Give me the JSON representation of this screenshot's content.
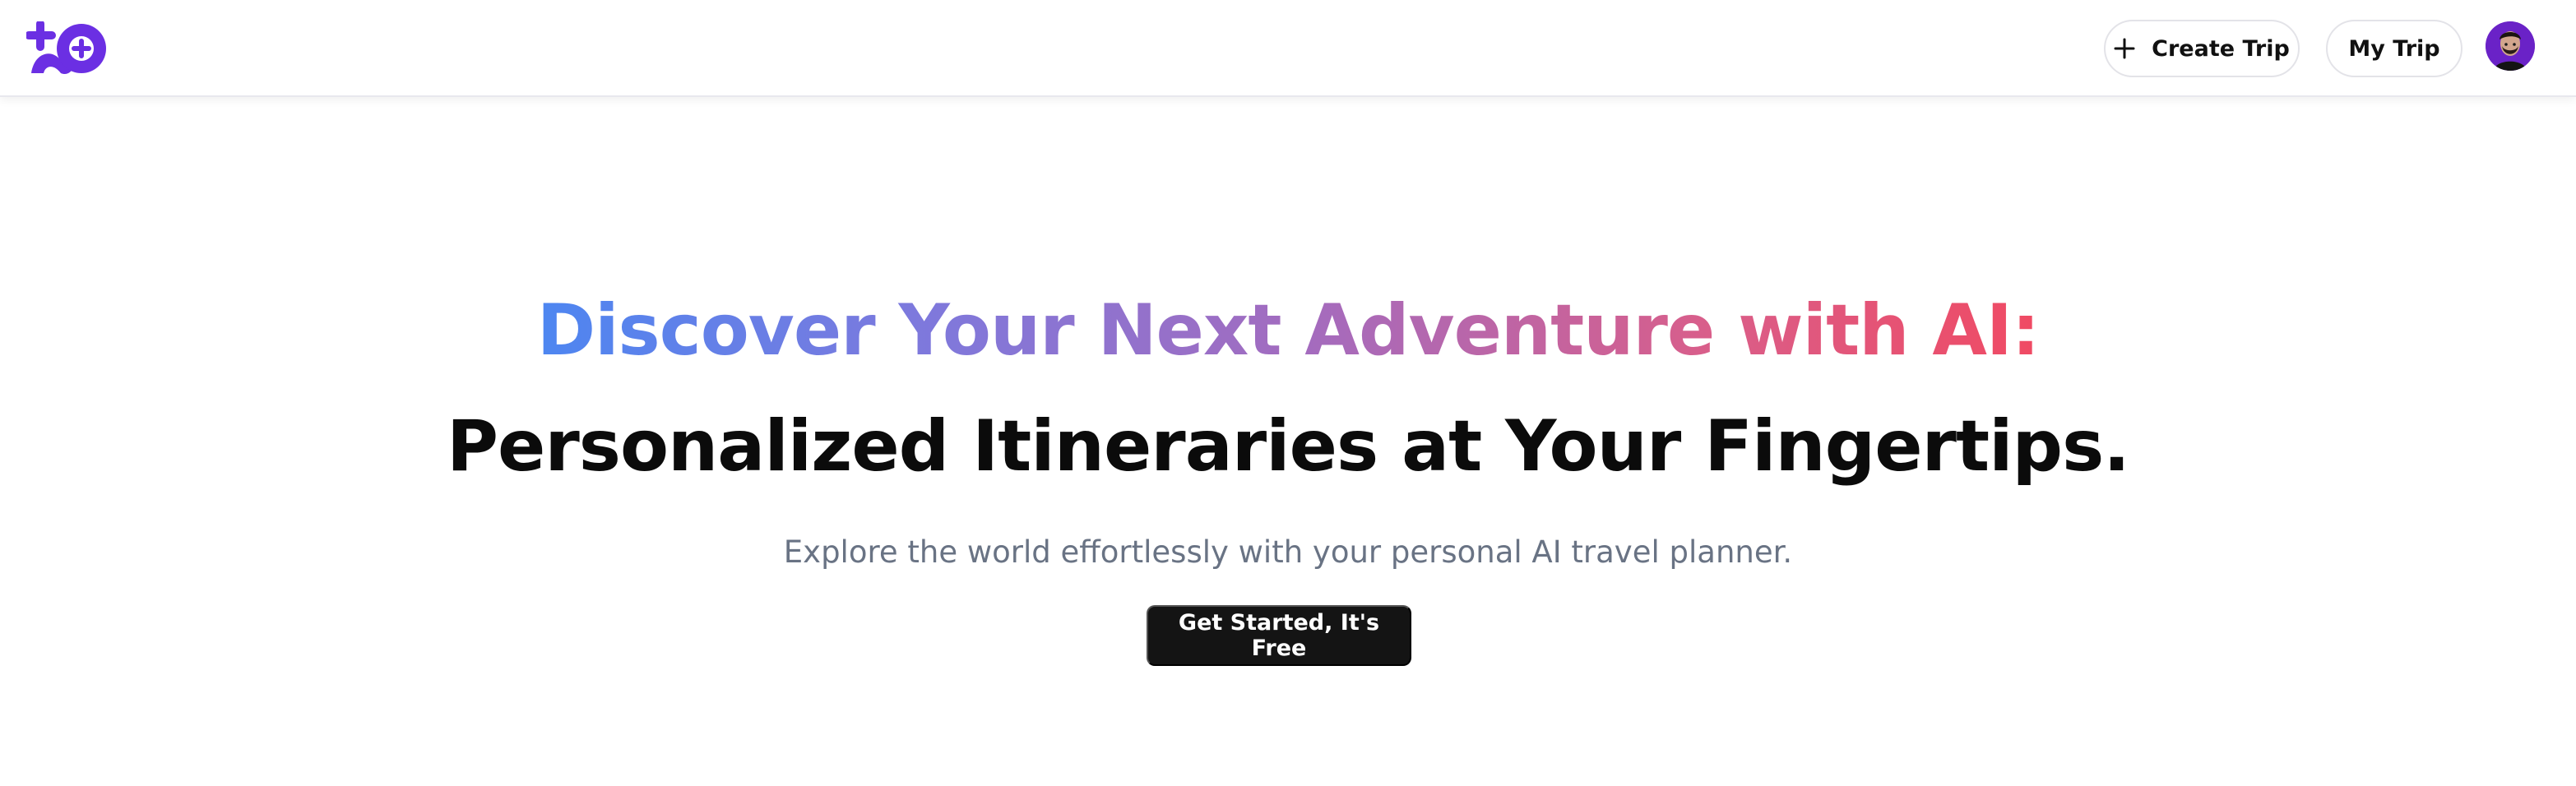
{
  "header": {
    "logo_icon": "sparkle-map-pin-logo-icon",
    "create_trip_label": "Create Trip",
    "create_trip_icon": "plus-icon",
    "my_trip_label": "My Trip",
    "avatar_icon": "user-avatar-icon"
  },
  "hero": {
    "headline_line_1": "Discover Your Next Adventure with AI:",
    "headline_line_2": "Personalized Itineraries at Your Fingertips.",
    "subtitle": "Explore the world effortlessly with your personal AI travel planner.",
    "cta_label": "Get Started, It's Free"
  },
  "colors": {
    "brand_purple": "#6b2fe3",
    "gradient_start": "#4d86f1",
    "gradient_middle": "#a56bbd",
    "gradient_end": "#f04a63",
    "headline_dark": "#0b0b0b",
    "subtitle_gray": "#697384",
    "button_dark": "#141414"
  }
}
